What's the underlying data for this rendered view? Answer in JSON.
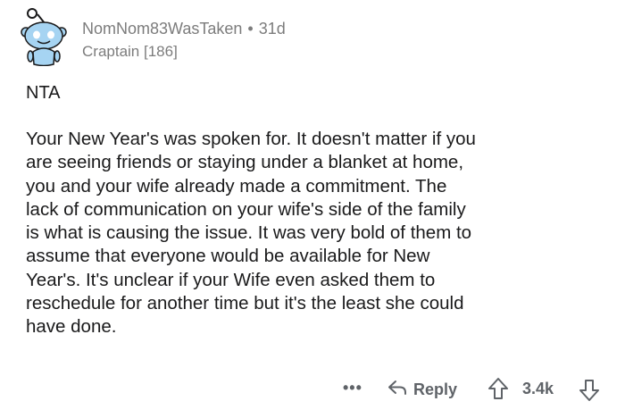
{
  "comment": {
    "author": "NomNom83WasTaken",
    "separator": "•",
    "age": "31d",
    "flair": "Craptain [186]",
    "title": "NTA",
    "body_lines": [
      "Your New Year's was spoken for. It doesn't matter if you",
      "are seeing friends or staying under a blanket at home,",
      "you and your wife already made a commitment. The",
      "lack of communication on your wife's side of the family",
      "is what is causing the issue. It was very bold of them to",
      "assume that everyone would be available for New",
      "Year's. It's unclear if your Wife even asked them to",
      "reschedule for another time but it's the least she could",
      "have done."
    ]
  },
  "actions": {
    "more": "•••",
    "reply_label": "Reply",
    "score": "3.4k"
  },
  "icons": {
    "avatar": "snoo-avatar-icon",
    "reply": "reply-arrow-icon",
    "upvote": "upvote-arrow-icon",
    "downvote": "downvote-arrow-icon",
    "more": "more-options-icon"
  },
  "colors": {
    "text": "#1a1a1b",
    "meta": "#7c7c7c",
    "action": "#5f6368",
    "avatar_blue": "#a6d4f2"
  }
}
